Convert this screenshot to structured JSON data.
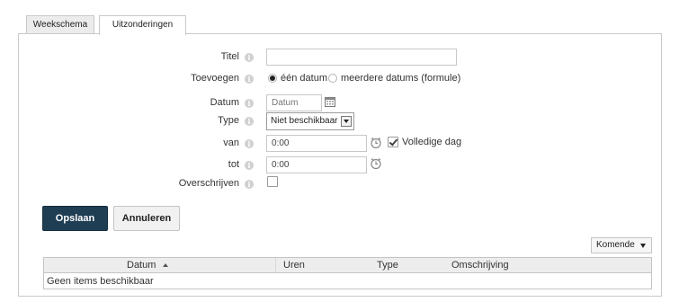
{
  "tabs": [
    {
      "label": "Weekschema",
      "active": false
    },
    {
      "label": "Uitzonderingen",
      "active": true
    }
  ],
  "form": {
    "titel_label": "Titel",
    "titel_value": "",
    "toevoegen_label": "Toevoegen",
    "toevoegen_options": [
      "één datum",
      "meerdere datums (formule)"
    ],
    "toevoegen_selected": "één datum",
    "datum_label": "Datum",
    "datum_placeholder": "Datum",
    "type_label": "Type",
    "type_value": "Niet beschikbaar",
    "van_label": "van",
    "van_value": "0:00",
    "volledige_dag_label": "Volledige dag",
    "volledige_dag_checked": true,
    "tot_label": "tot",
    "tot_value": "0:00",
    "overschrijven_label": "Overschrijven",
    "overschrijven_checked": false
  },
  "buttons": {
    "save": "Opslaan",
    "cancel": "Annuleren"
  },
  "filter": {
    "selected": "Komende"
  },
  "table": {
    "columns": [
      "Datum",
      "Uren",
      "Type",
      "Omschrijving"
    ],
    "sort_column": "Datum",
    "sort_direction": "ascending",
    "empty_message": "Geen items beschikbaar"
  },
  "icons": {
    "info": "info-icon",
    "calendar": "calendar-icon",
    "clock": "clock-icon",
    "sort": "sort-ascending-icon"
  },
  "colors": {
    "primary_button": "#1f3e53",
    "border": "#c9c9c9",
    "header_bg": "#ededed"
  }
}
